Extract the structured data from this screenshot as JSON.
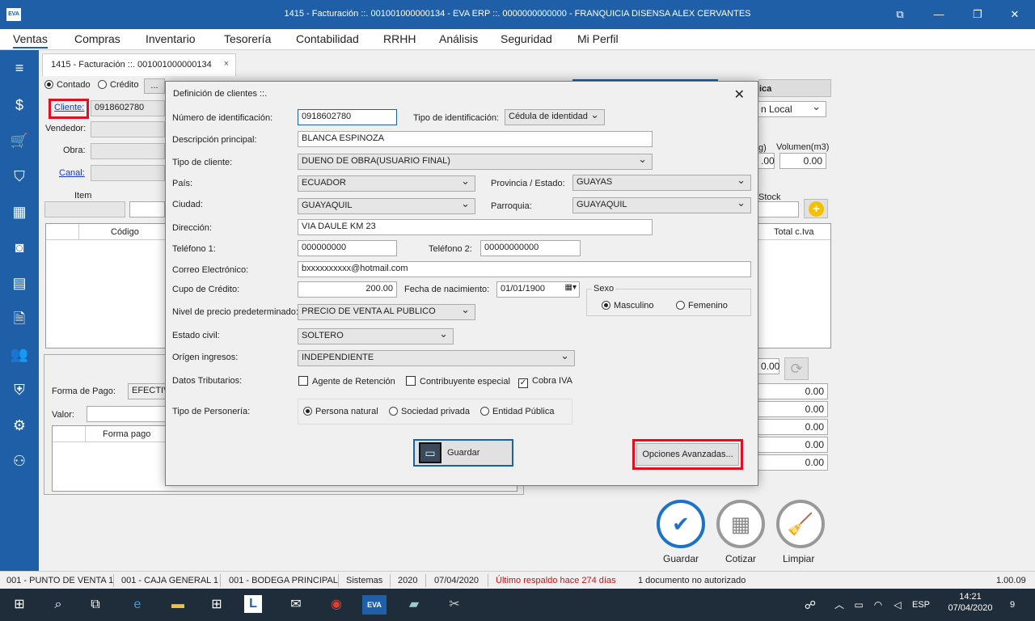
{
  "window": {
    "logo": "EVA",
    "title": "1415 - Facturación ::. 001001000000134 - EVA ERP ::. 0000000000000 - FRANQUICIA DISENSA ALEX CERVANTES"
  },
  "menu": [
    "Ventas",
    "Compras",
    "Inventario",
    "Tesorería",
    "Contabilidad",
    "RRHH",
    "Análisis",
    "Seguridad",
    "Mi Perfil"
  ],
  "doc_tab": {
    "label": "1415 - Facturación ::. 001001000000134",
    "close": "×"
  },
  "invoice": {
    "contado_label": "Contado",
    "credito_label": "Crédito",
    "dots": "...",
    "cliente_label": "Cliente:",
    "cliente_value": "0918602780",
    "vendedor_label": "Vendedor:",
    "obra_label": "Obra:",
    "canal_label": "Canal:",
    "item_label": "Item",
    "codigo_header": "Código",
    "total_header": "Total c.Iva",
    "forma_pago_label": "Forma de Pago:",
    "forma_pago_value": "EFECTIV",
    "valor_label": "Valor:",
    "forma_pago_col": "Forma pago",
    "right_tab_fragment": "ica",
    "local_fragment": "n Local",
    "peso_fragment": "g)",
    "volumen_label": "Volumen(m3)",
    "zero_a": ".00",
    "zero_b": "0.00",
    "stock_label": "Stock",
    "add_glyph": "+",
    "total_small": "0.00",
    "totals": [
      "0.00",
      "0.00",
      "0.00",
      "0.00",
      "0.00"
    ]
  },
  "actions": [
    {
      "label": "Guardar",
      "glyph": "✔"
    },
    {
      "label": "Cotizar",
      "glyph": "▦"
    },
    {
      "label": "Limpiar",
      "glyph": "🧹"
    }
  ],
  "modal": {
    "title": "Definición de clientes ::.",
    "close": "✕",
    "num_id_label": "Número de identificación:",
    "num_id_value": "0918602780",
    "tipo_id_label": "Tipo de identificación:",
    "tipo_id_value": "Cédula de identidad",
    "desc_label": "Descripción principal:",
    "desc_value": "BLANCA ESPINOZA",
    "tipo_cliente_label": "Tipo de cliente:",
    "tipo_cliente_value": "DUENO DE OBRA(USUARIO FINAL)",
    "pais_label": "País:",
    "pais_value": "ECUADOR",
    "provincia_label": "Provincia / Estado:",
    "provincia_value": "GUAYAS",
    "ciudad_label": "Ciudad:",
    "ciudad_value": "GUAYAQUIL",
    "parroquia_label": "Parroquia:",
    "parroquia_value": "GUAYAQUIL",
    "direccion_label": "Dirección:",
    "direccion_value": "VIA DAULE KM 23",
    "tel1_label": "Teléfono 1:",
    "tel1_value": "000000000",
    "tel2_label": "Teléfono 2:",
    "tel2_value": "00000000000",
    "correo_label": "Correo Electrónico:",
    "correo_value": "bxxxxxxxxxx@hotmail.com",
    "cupo_label": "Cupo de Crédito:",
    "cupo_value": "200.00",
    "fecha_label": "Fecha de nacimiento:",
    "fecha_value": "01/01/1900",
    "sexo_label": "Sexo",
    "masculino_label": "Masculino",
    "femenino_label": "Femenino",
    "nivel_label": "Nivel de precio predeterminado:",
    "nivel_value": "PRECIO DE VENTA AL PUBLICO",
    "estado_label": "Estado civil:",
    "estado_value": "SOLTERO",
    "origen_label": "Orígen ingresos:",
    "origen_value": "INDEPENDIENTE",
    "datos_label": "Datos Tributarios:",
    "agente_label": "Agente de Retención",
    "contribuyente_label": "Contribuyente especial",
    "cobra_label": "Cobra IVA",
    "check_mark": "✓",
    "personeria_label": "Tipo de Personería:",
    "natural_label": "Persona natural",
    "sociedad_label": "Sociedad privada",
    "entidad_label": "Entidad Pública",
    "guardar_label": "Guardar",
    "opciones_label": "Opciones Avanzadas..."
  },
  "status": {
    "punto": "001 - PUNTO DE VENTA 1",
    "caja": "001 - CAJA GENERAL 1",
    "bodega": "001 - BODEGA PRINCIPAL",
    "usuario": "Sistemas",
    "anio": "2020",
    "fecha": "07/04/2020",
    "respaldo": "Último respaldo hace 274 días",
    "documento": "1 documento no autorizado",
    "version": "1.00.09"
  },
  "taskbar": {
    "lang": "ESP",
    "time": "14:21",
    "date": "07/04/2020",
    "notif": "9",
    "eva": "EVA",
    "l": "L"
  },
  "colors": {
    "accent": "#1e5fa8",
    "highlight": "#e01020",
    "warning": "#d01010"
  }
}
